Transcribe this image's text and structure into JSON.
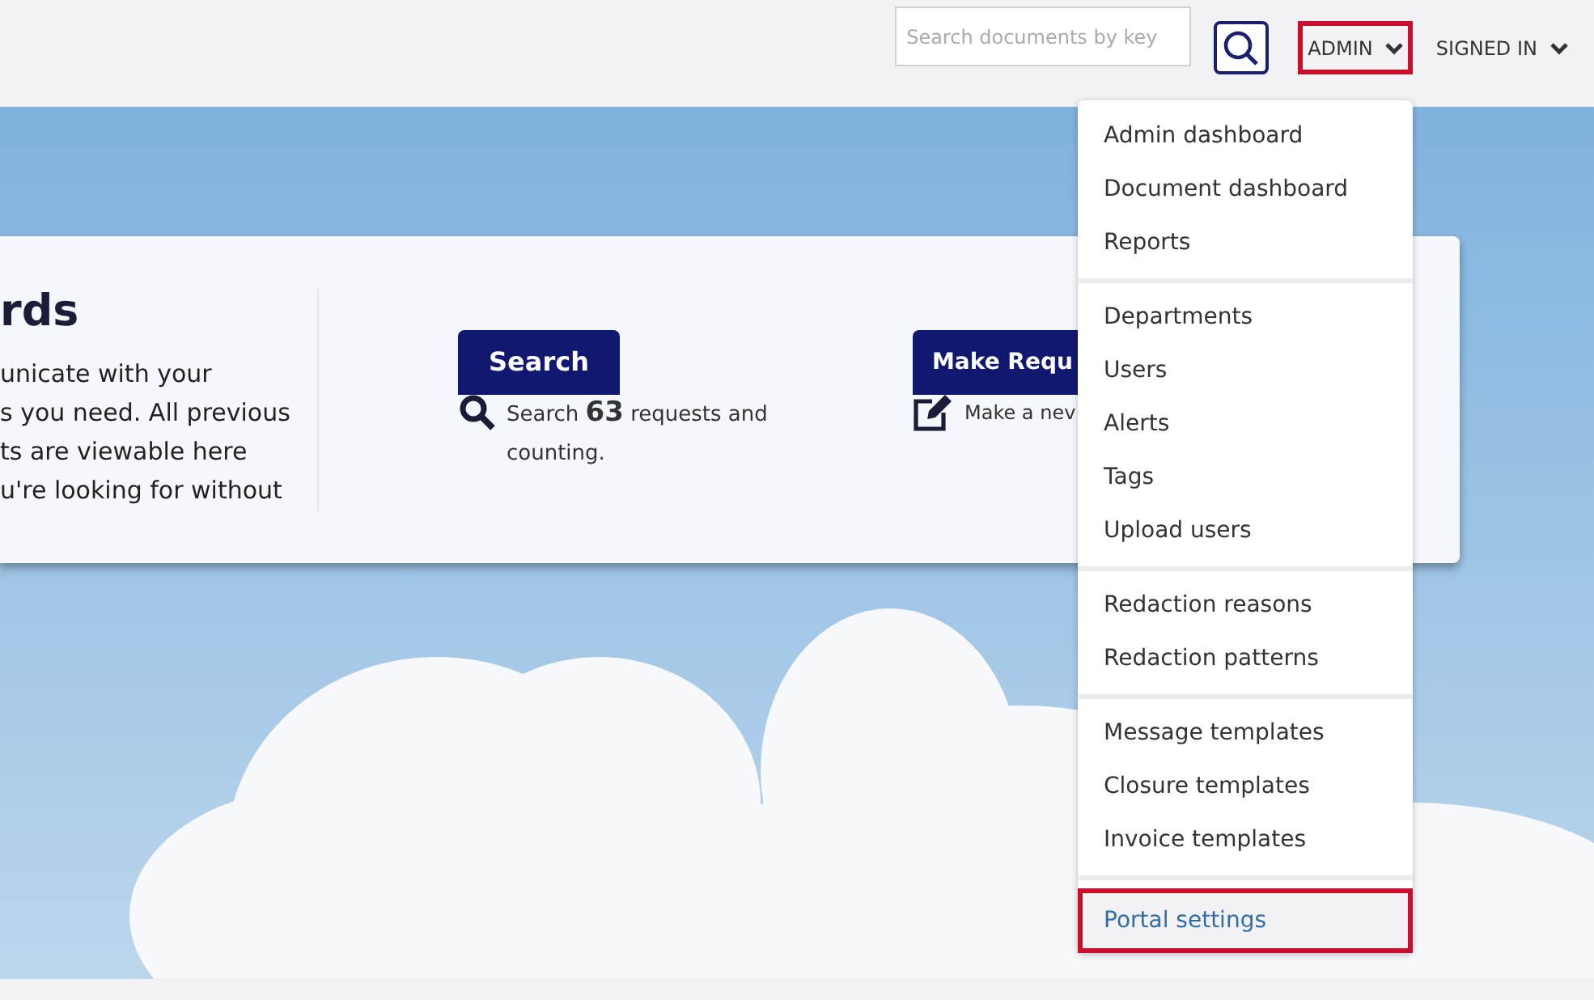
{
  "header": {
    "search": {
      "placeholder": "Search documents by key"
    },
    "admin_menu": {
      "label": "ADMIN",
      "expanded": true,
      "highlighted": true
    },
    "user_menu": {
      "label": "SIGNED IN",
      "expanded": false
    }
  },
  "hero": {
    "title": "rds",
    "description_lines": [
      "unicate with your",
      "s you need. All previous",
      "ts are viewable here",
      "u're looking for without"
    ],
    "actions": [
      {
        "kind": "search",
        "button": "Search",
        "caption": "Search **63** requests and counting."
      },
      {
        "kind": "request",
        "button": "Make Requ",
        "caption": "Make a nev"
      }
    ]
  },
  "admin_dropdown": {
    "groups": [
      [
        {
          "label": "Admin dashboard",
          "selected": false,
          "highlighted": false
        },
        {
          "label": "Document dashboard",
          "selected": false,
          "highlighted": false
        },
        {
          "label": "Reports",
          "selected": false,
          "highlighted": false
        }
      ],
      [
        {
          "label": "Departments",
          "selected": false,
          "highlighted": false
        },
        {
          "label": "Users",
          "selected": false,
          "highlighted": false
        },
        {
          "label": "Alerts",
          "selected": false,
          "highlighted": false
        },
        {
          "label": "Tags",
          "selected": false,
          "highlighted": false
        },
        {
          "label": "Upload users",
          "selected": false,
          "highlighted": false
        }
      ],
      [
        {
          "label": "Redaction reasons",
          "selected": false,
          "highlighted": false
        },
        {
          "label": "Redaction patterns",
          "selected": false,
          "highlighted": false
        }
      ],
      [
        {
          "label": "Message templates",
          "selected": false,
          "highlighted": false
        },
        {
          "label": "Closure templates",
          "selected": false,
          "highlighted": false
        },
        {
          "label": "Invoice templates",
          "selected": false,
          "highlighted": false
        }
      ],
      [
        {
          "label": "Portal settings",
          "selected": true,
          "highlighted": true
        }
      ]
    ]
  }
}
